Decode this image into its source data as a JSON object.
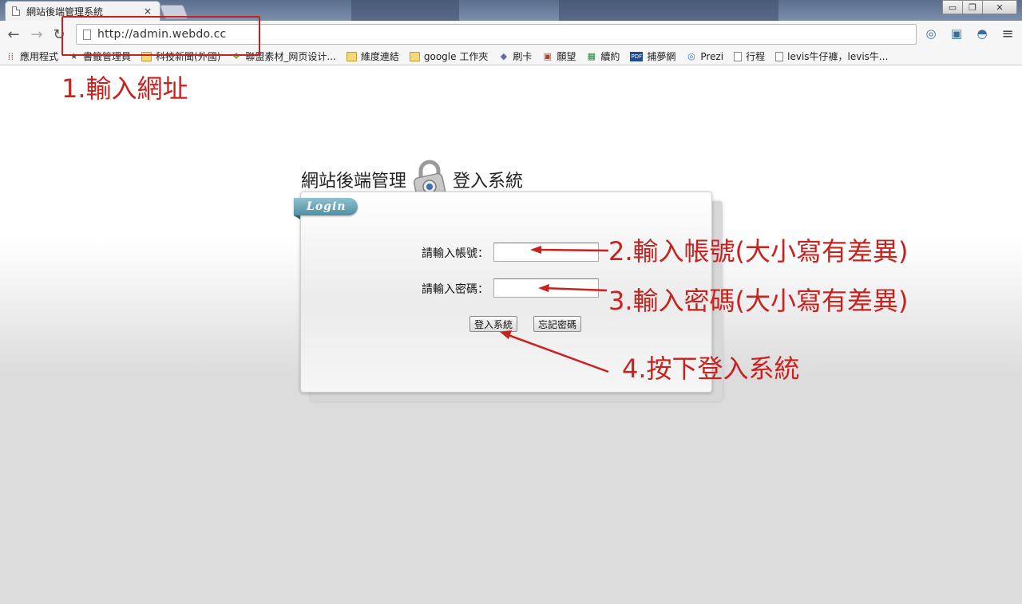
{
  "browser": {
    "tab_title": "網站後端管理系統",
    "tab_close": "×",
    "url": "http://admin.webdo.cc",
    "window_controls": {
      "minimize": "▭",
      "restore": "❐",
      "close": "✕"
    },
    "nav": {
      "back": "←",
      "forward": "→",
      "reload": "↻"
    },
    "menu_glyph": "≡"
  },
  "bookmarks": [
    {
      "label": "應用程式",
      "icon": "apps-icon"
    },
    {
      "label": "書籤管理員",
      "icon": "star-icon"
    },
    {
      "label": "科技新聞(外國)",
      "icon": "folder-icon"
    },
    {
      "label": "聯盟素材_网页设计...",
      "icon": "leaf-icon"
    },
    {
      "label": "維度連結",
      "icon": "folder-icon"
    },
    {
      "label": "google 工作夾",
      "icon": "folder-icon"
    },
    {
      "label": "刷卡",
      "icon": "diamond-icon"
    },
    {
      "label": "願望",
      "icon": "book-icon"
    },
    {
      "label": "續約",
      "icon": "sheet-icon"
    },
    {
      "label": "捕夢網",
      "icon": "pdf-icon"
    },
    {
      "label": "Prezi",
      "icon": "prezi-icon"
    },
    {
      "label": "行程",
      "icon": "page-icon"
    },
    {
      "label": "levis牛仔褲，levis牛...",
      "icon": "page-icon"
    }
  ],
  "page": {
    "heading_left": "網站後端管理",
    "heading_right": "登入系統",
    "login_label": "Login",
    "account_label": "請輸入帳號：",
    "account_value": "",
    "password_label": "請輸入密碼：",
    "password_value": "",
    "login_button": "登入系統",
    "forgot_button": "忘記密碼"
  },
  "annotations": {
    "step1": "1.輸入網址",
    "step2": "2.輸入帳號(大小寫有差異)",
    "step3": "3.輸入密碼(大小寫有差異)",
    "step4": "4.按下登入系統",
    "color": "#c9211e"
  }
}
